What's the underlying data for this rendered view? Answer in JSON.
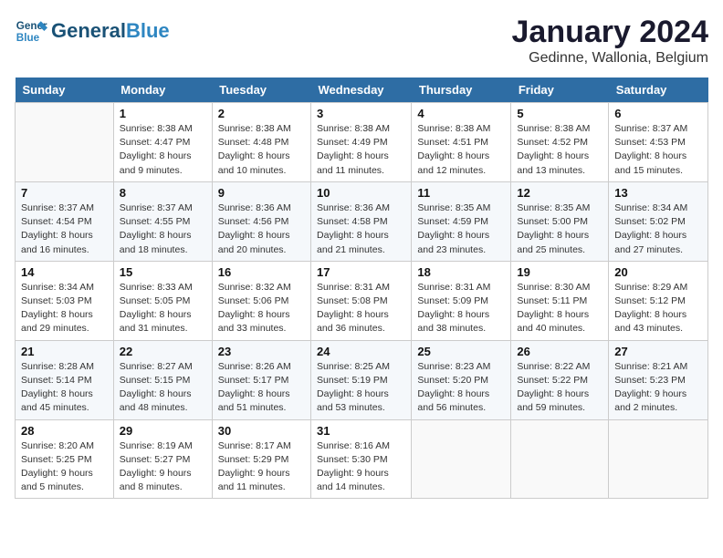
{
  "header": {
    "logo_text_general": "General",
    "logo_text_blue": "Blue",
    "month_title": "January 2024",
    "subtitle": "Gedinne, Wallonia, Belgium"
  },
  "weekdays": [
    "Sunday",
    "Monday",
    "Tuesday",
    "Wednesday",
    "Thursday",
    "Friday",
    "Saturday"
  ],
  "weeks": [
    [
      {
        "day": "",
        "sunrise": "",
        "sunset": "",
        "daylight": ""
      },
      {
        "day": "1",
        "sunrise": "Sunrise: 8:38 AM",
        "sunset": "Sunset: 4:47 PM",
        "daylight": "Daylight: 8 hours and 9 minutes."
      },
      {
        "day": "2",
        "sunrise": "Sunrise: 8:38 AM",
        "sunset": "Sunset: 4:48 PM",
        "daylight": "Daylight: 8 hours and 10 minutes."
      },
      {
        "day": "3",
        "sunrise": "Sunrise: 8:38 AM",
        "sunset": "Sunset: 4:49 PM",
        "daylight": "Daylight: 8 hours and 11 minutes."
      },
      {
        "day": "4",
        "sunrise": "Sunrise: 8:38 AM",
        "sunset": "Sunset: 4:51 PM",
        "daylight": "Daylight: 8 hours and 12 minutes."
      },
      {
        "day": "5",
        "sunrise": "Sunrise: 8:38 AM",
        "sunset": "Sunset: 4:52 PM",
        "daylight": "Daylight: 8 hours and 13 minutes."
      },
      {
        "day": "6",
        "sunrise": "Sunrise: 8:37 AM",
        "sunset": "Sunset: 4:53 PM",
        "daylight": "Daylight: 8 hours and 15 minutes."
      }
    ],
    [
      {
        "day": "7",
        "sunrise": "Sunrise: 8:37 AM",
        "sunset": "Sunset: 4:54 PM",
        "daylight": "Daylight: 8 hours and 16 minutes."
      },
      {
        "day": "8",
        "sunrise": "Sunrise: 8:37 AM",
        "sunset": "Sunset: 4:55 PM",
        "daylight": "Daylight: 8 hours and 18 minutes."
      },
      {
        "day": "9",
        "sunrise": "Sunrise: 8:36 AM",
        "sunset": "Sunset: 4:56 PM",
        "daylight": "Daylight: 8 hours and 20 minutes."
      },
      {
        "day": "10",
        "sunrise": "Sunrise: 8:36 AM",
        "sunset": "Sunset: 4:58 PM",
        "daylight": "Daylight: 8 hours and 21 minutes."
      },
      {
        "day": "11",
        "sunrise": "Sunrise: 8:35 AM",
        "sunset": "Sunset: 4:59 PM",
        "daylight": "Daylight: 8 hours and 23 minutes."
      },
      {
        "day": "12",
        "sunrise": "Sunrise: 8:35 AM",
        "sunset": "Sunset: 5:00 PM",
        "daylight": "Daylight: 8 hours and 25 minutes."
      },
      {
        "day": "13",
        "sunrise": "Sunrise: 8:34 AM",
        "sunset": "Sunset: 5:02 PM",
        "daylight": "Daylight: 8 hours and 27 minutes."
      }
    ],
    [
      {
        "day": "14",
        "sunrise": "Sunrise: 8:34 AM",
        "sunset": "Sunset: 5:03 PM",
        "daylight": "Daylight: 8 hours and 29 minutes."
      },
      {
        "day": "15",
        "sunrise": "Sunrise: 8:33 AM",
        "sunset": "Sunset: 5:05 PM",
        "daylight": "Daylight: 8 hours and 31 minutes."
      },
      {
        "day": "16",
        "sunrise": "Sunrise: 8:32 AM",
        "sunset": "Sunset: 5:06 PM",
        "daylight": "Daylight: 8 hours and 33 minutes."
      },
      {
        "day": "17",
        "sunrise": "Sunrise: 8:31 AM",
        "sunset": "Sunset: 5:08 PM",
        "daylight": "Daylight: 8 hours and 36 minutes."
      },
      {
        "day": "18",
        "sunrise": "Sunrise: 8:31 AM",
        "sunset": "Sunset: 5:09 PM",
        "daylight": "Daylight: 8 hours and 38 minutes."
      },
      {
        "day": "19",
        "sunrise": "Sunrise: 8:30 AM",
        "sunset": "Sunset: 5:11 PM",
        "daylight": "Daylight: 8 hours and 40 minutes."
      },
      {
        "day": "20",
        "sunrise": "Sunrise: 8:29 AM",
        "sunset": "Sunset: 5:12 PM",
        "daylight": "Daylight: 8 hours and 43 minutes."
      }
    ],
    [
      {
        "day": "21",
        "sunrise": "Sunrise: 8:28 AM",
        "sunset": "Sunset: 5:14 PM",
        "daylight": "Daylight: 8 hours and 45 minutes."
      },
      {
        "day": "22",
        "sunrise": "Sunrise: 8:27 AM",
        "sunset": "Sunset: 5:15 PM",
        "daylight": "Daylight: 8 hours and 48 minutes."
      },
      {
        "day": "23",
        "sunrise": "Sunrise: 8:26 AM",
        "sunset": "Sunset: 5:17 PM",
        "daylight": "Daylight: 8 hours and 51 minutes."
      },
      {
        "day": "24",
        "sunrise": "Sunrise: 8:25 AM",
        "sunset": "Sunset: 5:19 PM",
        "daylight": "Daylight: 8 hours and 53 minutes."
      },
      {
        "day": "25",
        "sunrise": "Sunrise: 8:23 AM",
        "sunset": "Sunset: 5:20 PM",
        "daylight": "Daylight: 8 hours and 56 minutes."
      },
      {
        "day": "26",
        "sunrise": "Sunrise: 8:22 AM",
        "sunset": "Sunset: 5:22 PM",
        "daylight": "Daylight: 8 hours and 59 minutes."
      },
      {
        "day": "27",
        "sunrise": "Sunrise: 8:21 AM",
        "sunset": "Sunset: 5:23 PM",
        "daylight": "Daylight: 9 hours and 2 minutes."
      }
    ],
    [
      {
        "day": "28",
        "sunrise": "Sunrise: 8:20 AM",
        "sunset": "Sunset: 5:25 PM",
        "daylight": "Daylight: 9 hours and 5 minutes."
      },
      {
        "day": "29",
        "sunrise": "Sunrise: 8:19 AM",
        "sunset": "Sunset: 5:27 PM",
        "daylight": "Daylight: 9 hours and 8 minutes."
      },
      {
        "day": "30",
        "sunrise": "Sunrise: 8:17 AM",
        "sunset": "Sunset: 5:29 PM",
        "daylight": "Daylight: 9 hours and 11 minutes."
      },
      {
        "day": "31",
        "sunrise": "Sunrise: 8:16 AM",
        "sunset": "Sunset: 5:30 PM",
        "daylight": "Daylight: 9 hours and 14 minutes."
      },
      {
        "day": "",
        "sunrise": "",
        "sunset": "",
        "daylight": ""
      },
      {
        "day": "",
        "sunrise": "",
        "sunset": "",
        "daylight": ""
      },
      {
        "day": "",
        "sunrise": "",
        "sunset": "",
        "daylight": ""
      }
    ]
  ]
}
